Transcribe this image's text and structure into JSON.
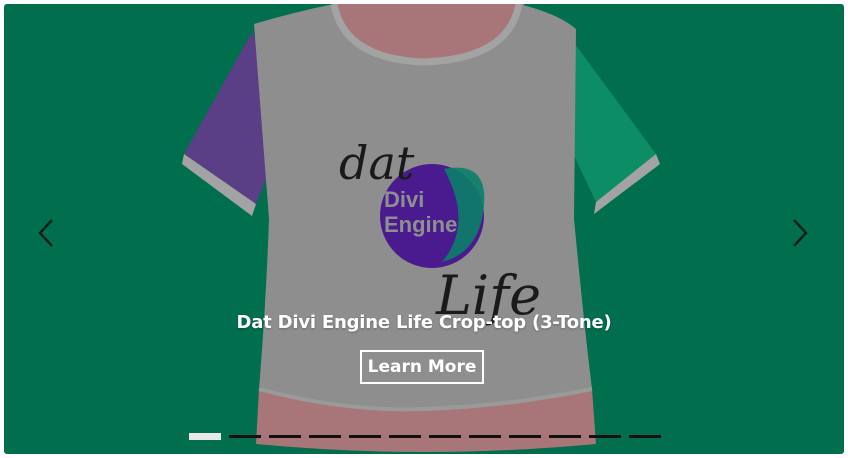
{
  "slide": {
    "title": "Dat Divi Engine Life Crop-top (3-Tone)",
    "button_label": "Learn More"
  },
  "artwork": {
    "line1": "dat",
    "line2": "Divi",
    "line3": "Engine",
    "line4": "Life"
  },
  "navigation": {
    "prev_icon": "chevron-left-icon",
    "next_icon": "chevron-right-icon",
    "dot_count": 12,
    "active_dot": 0
  },
  "colors": {
    "background": "#016e4e",
    "shirt_body": "#8e8e8e",
    "left_sleeve": "#5a3f86",
    "right_sleeve": "#0d8d66",
    "inner_lining": "#a87579",
    "text": "#ffffff"
  }
}
